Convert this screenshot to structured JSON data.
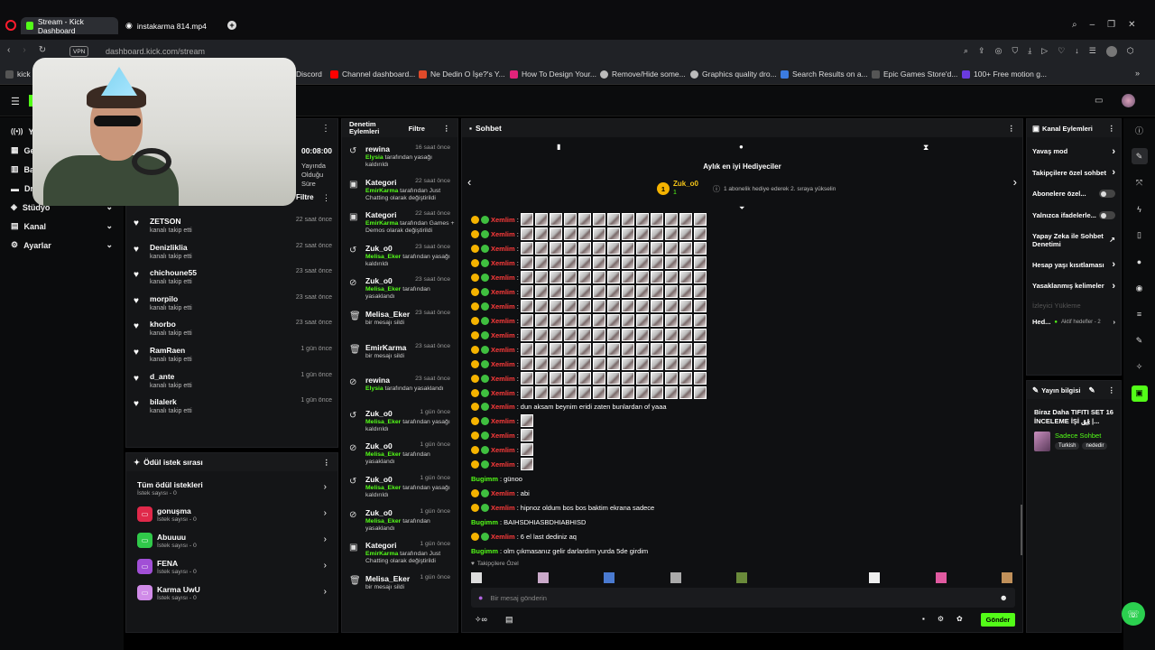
{
  "browser": {
    "tabs": [
      {
        "label": "Stream - Kick Dashboard"
      },
      {
        "label": "instakarma 814.mp4"
      }
    ],
    "vpn": "VPN",
    "url": "dashboard.kick.com/stream",
    "bookmarks": [
      {
        "label": "kick"
      },
      {
        "label": "Discord"
      },
      {
        "label": "Channel dashboard..."
      },
      {
        "label": "Ne Dedin O İşe?'s Y..."
      },
      {
        "label": "How To Design Your..."
      },
      {
        "label": "Remove/Hide some..."
      },
      {
        "label": "Graphics quality dro..."
      },
      {
        "label": "Search Results on a..."
      },
      {
        "label": "Epic Games Store'd..."
      },
      {
        "label": "100+ Free motion g..."
      }
    ]
  },
  "leftnav": {
    "items": [
      {
        "label": "Ya"
      },
      {
        "label": "Ge"
      },
      {
        "label": "Ba"
      },
      {
        "label": "Dr"
      },
      {
        "label": "Stüdyo"
      },
      {
        "label": "Kanal"
      },
      {
        "label": "Ayarlar"
      }
    ]
  },
  "session": {
    "time": "00:08:00",
    "status": "Yayında Olduğu Süre",
    "filter": "Filtre"
  },
  "followers": [
    {
      "name": "ZETSON",
      "sub": "kanalı takip etti",
      "time": "22 saat önce"
    },
    {
      "name": "Denizliklia",
      "sub": "kanalı takip etti",
      "time": "22 saat önce"
    },
    {
      "name": "chichoune55",
      "sub": "kanalı takip etti",
      "time": "23 saat önce"
    },
    {
      "name": "morpilo",
      "sub": "kanalı takip etti",
      "time": "23 saat önce"
    },
    {
      "name": "khorbo",
      "sub": "kanalı takip etti",
      "time": "23 saat önce"
    },
    {
      "name": "RamRaen",
      "sub": "kanalı takip etti",
      "time": "1 gün önce"
    },
    {
      "name": "d_ante",
      "sub": "kanalı takip etti",
      "time": "1 gün önce"
    },
    {
      "name": "bilalerk",
      "sub": "kanalı takip etti",
      "time": "1 gün önce"
    }
  ],
  "rewards": {
    "title": "Ödül istek sırası",
    "all_label": "Tüm ödül istekleri",
    "all_sub": "İstek sayısı - 0",
    "items": [
      {
        "name": "gonuşma",
        "sub": "İstek sayısı - 0",
        "color": "#e0294a"
      },
      {
        "name": "Abuuuu",
        "sub": "İstek sayısı - 0",
        "color": "#30c94a"
      },
      {
        "name": "FENA",
        "sub": "İstek sayısı - 0",
        "color": "#a14fd6"
      },
      {
        "name": "Karma UwU",
        "sub": "İstek sayısı - 0",
        "color": "#d08be8"
      }
    ]
  },
  "modactions": {
    "title": "Denetim Eylemleri",
    "filter": "Filtre",
    "items": [
      {
        "name": "rewina",
        "actor": "Elysia",
        "text": "tarafından yasağı kaldırıldı",
        "time": "16 saat önce",
        "icon": "undo-icon"
      },
      {
        "name": "Kategori",
        "actor": "EmirKarma",
        "text": "tarafından Just Chatting olarak değiştirildi",
        "time": "22 saat önce",
        "icon": "category-icon"
      },
      {
        "name": "Kategori",
        "actor": "EmirKarma",
        "text": "tarafından Games + Demos olarak değiştirildi",
        "time": "22 saat önce",
        "icon": "category-icon"
      },
      {
        "name": "Zuk_o0",
        "actor": "Melisa_Eker",
        "text": "tarafından yasağı kaldırıldı",
        "time": "23 saat önce",
        "icon": "undo-icon"
      },
      {
        "name": "Zuk_o0",
        "actor": "Melisa_Eker",
        "text": "tarafından yasaklandı",
        "time": "23 saat önce",
        "icon": "ban-icon"
      },
      {
        "name": "Melisa_Eker",
        "actor": "",
        "text": "bir mesajı sildi",
        "time": "23 saat önce",
        "icon": "trash-icon"
      },
      {
        "name": "EmirKarma",
        "actor": "",
        "text": "bir mesajı sildi",
        "time": "23 saat önce",
        "icon": "trash-icon"
      },
      {
        "name": "rewina",
        "actor": "Elysia",
        "text": "tarafından yasaklandı",
        "time": "23 saat önce",
        "icon": "ban-icon"
      },
      {
        "name": "Zuk_o0",
        "actor": "Melisa_Eker",
        "text": "tarafından yasağı kaldırıldı",
        "time": "1 gün önce",
        "icon": "undo-icon"
      },
      {
        "name": "Zuk_o0",
        "actor": "Melisa_Eker",
        "text": "tarafından yasaklandı",
        "time": "1 gün önce",
        "icon": "ban-icon"
      },
      {
        "name": "Zuk_o0",
        "actor": "Melisa_Eker",
        "text": "tarafından yasağı kaldırıldı",
        "time": "1 gün önce",
        "icon": "undo-icon"
      },
      {
        "name": "Zuk_o0",
        "actor": "Melisa_Eker",
        "text": "tarafından yasaklandı",
        "time": "1 gün önce",
        "icon": "ban-icon"
      },
      {
        "name": "Kategori",
        "actor": "EmirKarma",
        "text": "tarafından Just Chatting olarak değiştirildi",
        "time": "1 gün önce",
        "icon": "category-icon"
      },
      {
        "name": "Melisa_Eker",
        "actor": "",
        "text": "bir mesajı sildi",
        "time": "1 gün önce",
        "icon": "trash-icon"
      }
    ]
  },
  "chat": {
    "title": "Sohbet",
    "gifters_title": "Aylık en iyi Hediyeciler",
    "gifter_rank": "1",
    "gifter_name": "Zuk_o0",
    "gifter_count": "1",
    "gifter_note": "1 abonelik hediye ederek 2. sıraya yükselin",
    "spammer": "Xemlim",
    "emote_rows": 13,
    "emote_cols": 13,
    "lines": [
      {
        "user": "Xemlim",
        "text": "dun aksam beynim eridi zaten bunlardan of yaaa",
        "badges": true,
        "user_color": "#ff3b3b"
      },
      {
        "user": "Xemlim",
        "text": "",
        "badges": true,
        "user_color": "#ff3b3b",
        "emote": true
      },
      {
        "user": "Xemlim",
        "text": "",
        "badges": true,
        "user_color": "#ff3b3b",
        "emote": true
      },
      {
        "user": "Xemlim",
        "text": "",
        "badges": true,
        "user_color": "#ff3b3b",
        "emote": true
      },
      {
        "user": "Xemlim",
        "text": "",
        "badges": true,
        "user_color": "#ff3b3b",
        "emote": true
      },
      {
        "user": "Bugimm",
        "text": "günoo",
        "badges": false,
        "user_color": "#53fc18"
      },
      {
        "user": "Xemlim",
        "text": "abi",
        "badges": true,
        "user_color": "#ff3b3b"
      },
      {
        "user": "Xemlim",
        "text": "hipnoz oldum bos bos baktim ekrana sadece",
        "badges": true,
        "user_color": "#ff3b3b"
      },
      {
        "user": "Bugimm",
        "text": "BAIHSDHIASBDHIABHISD",
        "badges": false,
        "user_color": "#53fc18"
      },
      {
        "user": "Xemlim",
        "text": "6 el last dediniz aq",
        "badges": true,
        "user_color": "#ff3b3b"
      },
      {
        "user": "Bugimm",
        "text": "olm çıkmasanız gelir darlardım yurda 5de girdim",
        "badges": false,
        "user_color": "#53fc18"
      }
    ],
    "followers_only_label": "Takipçilere Özel",
    "placeholder": "Bir mesaj gönderin",
    "send_label": "Gönder"
  },
  "channel_actions": {
    "title": "Kanal Eylemleri",
    "items": [
      {
        "label": "Yavaş mod",
        "type": "chevron"
      },
      {
        "label": "Takipçilere özel sohbet",
        "type": "chevron"
      },
      {
        "label": "Abonelere özel...",
        "type": "toggle"
      },
      {
        "label": "Yalnızca ifadelerle...",
        "type": "toggle"
      },
      {
        "label": "Yapay Zeka ile Sohbet Denetimi",
        "type": "external"
      },
      {
        "label": "Hesap yaşı kısıtlaması",
        "type": "chevron"
      },
      {
        "label": "Yasaklanmış kelimeler",
        "type": "chevron"
      }
    ],
    "disabled_label": "İzleyici Yükleme",
    "goals_label": "Hed...",
    "goals_status": "Aktif hedefler - 2"
  },
  "stream_info": {
    "title": "Yayın bilgisi",
    "stream_title": "Biraz Daha TIFITI SET 16 İNCELEME İŞİ ق͜ق |...",
    "mode": "Sadece Sohbet",
    "tags": [
      "Turkish",
      "nededir"
    ]
  }
}
